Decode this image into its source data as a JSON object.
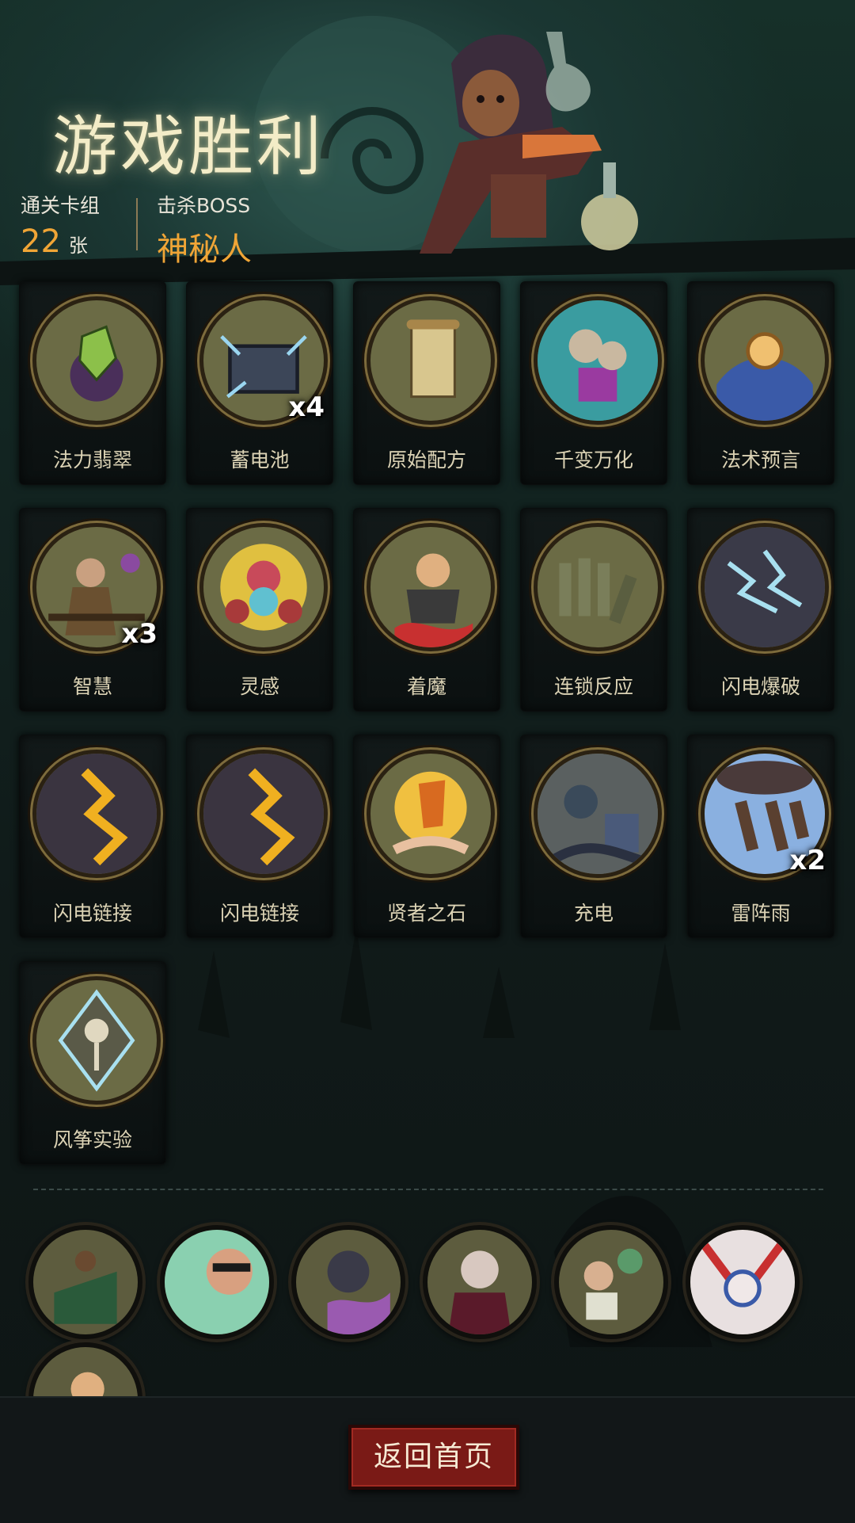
{
  "header": {
    "title": "游戏胜利",
    "deck_label": "通关卡组",
    "deck_count": "22",
    "deck_unit": "张",
    "boss_label": "击杀BOSS",
    "boss_name": "神秘人"
  },
  "cards": [
    {
      "name": "法力翡翠",
      "count": "",
      "icon": "emerald-crystal-icon"
    },
    {
      "name": "蓄电池",
      "count": "x4",
      "icon": "battery-box-icon"
    },
    {
      "name": "原始配方",
      "count": "",
      "icon": "scroll-icon"
    },
    {
      "name": "千变万化",
      "count": "",
      "icon": "jester-box-icon"
    },
    {
      "name": "法术预言",
      "count": "",
      "icon": "crystal-orb-icon"
    },
    {
      "name": "智慧",
      "count": "x3",
      "icon": "sage-icon"
    },
    {
      "name": "灵感",
      "count": "",
      "icon": "brain-skull-icon"
    },
    {
      "name": "着魔",
      "count": "",
      "icon": "possessed-man-icon"
    },
    {
      "name": "连锁反应",
      "count": "",
      "icon": "dominoes-icon"
    },
    {
      "name": "闪电爆破",
      "count": "",
      "icon": "lightning-burst-icon"
    },
    {
      "name": "闪电链接",
      "count": "",
      "icon": "lightning-chain-icon"
    },
    {
      "name": "闪电链接",
      "count": "",
      "icon": "lightning-chain-icon"
    },
    {
      "name": "贤者之石",
      "count": "",
      "icon": "philosopher-stone-icon"
    },
    {
      "name": "充电",
      "count": "",
      "icon": "charge-icon"
    },
    {
      "name": "雷阵雨",
      "count": "x2",
      "icon": "thunderstorm-icon"
    },
    {
      "name": "风筝实验",
      "count": "",
      "icon": "kite-experiment-icon"
    }
  ],
  "relics": [
    {
      "icon": "scarecrow-badge-icon"
    },
    {
      "icon": "masked-man-icon"
    },
    {
      "icon": "cat-creature-icon"
    },
    {
      "icon": "vampire-icon"
    },
    {
      "icon": "zombie-scholar-icon"
    },
    {
      "icon": "rabbit-icon"
    },
    {
      "icon": "possessed-man-icon"
    }
  ],
  "footer": {
    "home_button": "返回首页"
  },
  "colors": {
    "accent": "#f0a536",
    "button": "#7a1a16",
    "card_frame": "#7d6b3c"
  }
}
